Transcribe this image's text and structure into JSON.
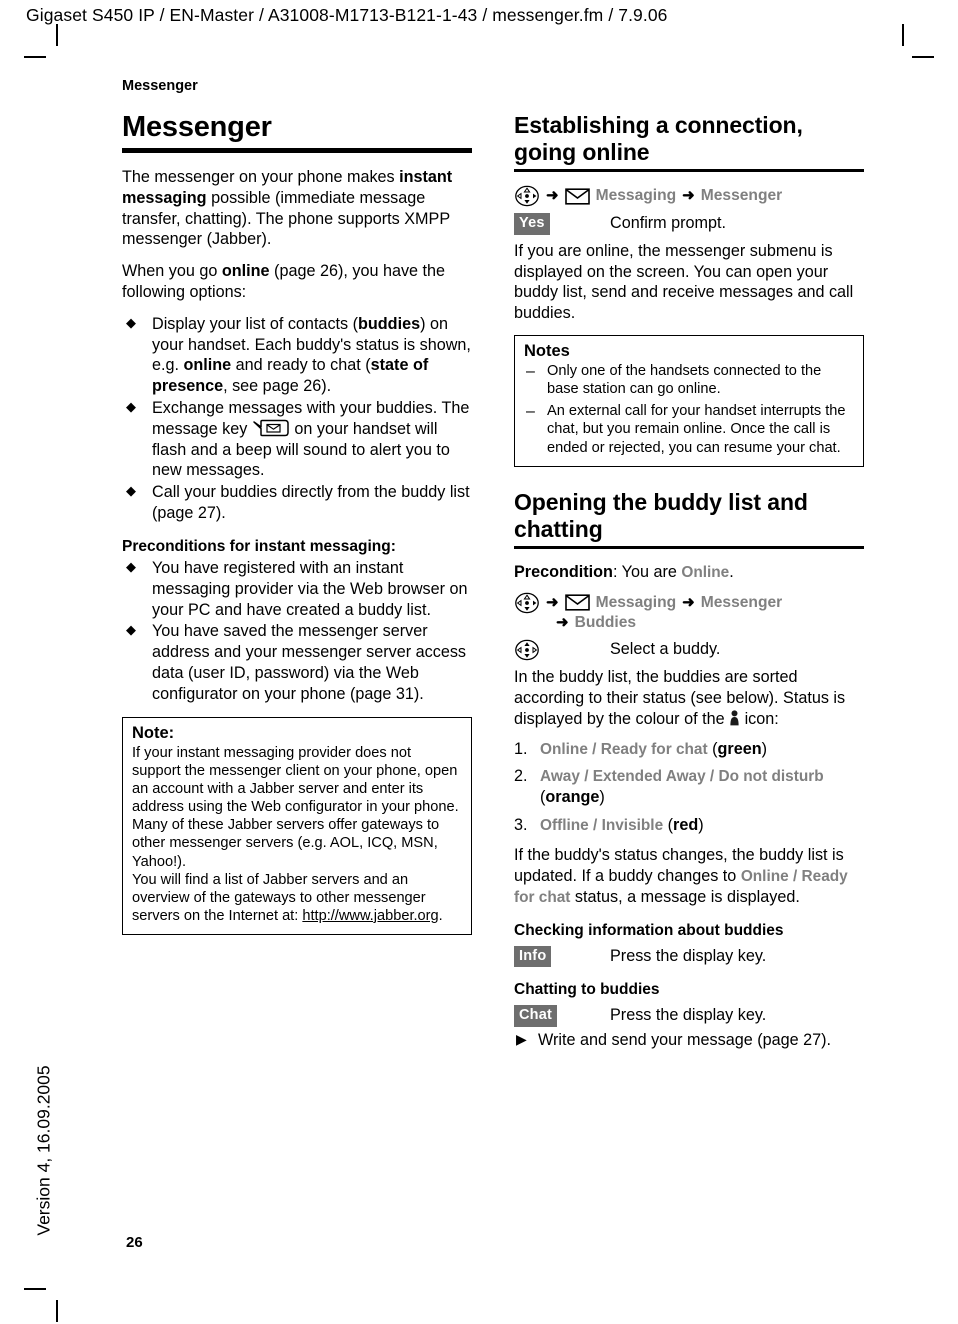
{
  "print_header": "Gigaset S450 IP / EN-Master / A31008-M1713-B121-1-43 / messenger.fm / 7.9.06",
  "version_note": "Version 4, 16.09.2005",
  "running_head": "Messenger",
  "page_number": "26",
  "colors": {
    "gray_term": "#808080",
    "display_key_bg": "#6e6e6e",
    "rule": "#000000"
  },
  "left_column": {
    "chapter_title": "Messenger",
    "intro_p1_a": "The messenger on your phone makes ",
    "intro_p1_b": "instant messaging",
    "intro_p1_c": " possible (immediate message transfer, chatting). The phone supports XMPP messenger (Jabber).",
    "intro_p2_a": "When you go ",
    "intro_p2_b": "online",
    "intro_p2_c": " (page 26), you have the following options:",
    "options": [
      {
        "bullet": "◆",
        "a": "Display your list of contacts (",
        "b1": "buddies",
        "c": ") on your handset. Each buddy's status is shown, e.g. ",
        "b2": "online",
        "d": " and ready to chat (",
        "b3": "state of presence",
        "e": ", see page 26)."
      },
      {
        "bullet": "◆",
        "a": "Exchange messages with your buddies. The message key ",
        "icon": "message-key-icon",
        "c": " on your handset will flash and a beep will sound to alert you to new messages."
      },
      {
        "bullet": "◆",
        "a": "Call your buddies directly from the buddy list (page 27)."
      }
    ],
    "preconditions_title": "Preconditions for instant messaging:",
    "preconditions": [
      {
        "bullet": "◆",
        "text": "You have registered with an instant messaging provider via the Web browser on your PC and have created a buddy list."
      },
      {
        "bullet": "◆",
        "text": "You have saved the messenger server address and your messenger server access data (user ID, password) via the Web configurator on your phone (page 31)."
      }
    ],
    "note_box": {
      "title": "Note:",
      "para1": "If your instant messaging provider does not support the messenger client on your phone, open an account with a Jabber server and enter its address using the Web configurator in your phone. Many of these Jabber servers offer gateways to other messenger servers (e.g. AOL, ICQ, MSN, Yahoo!).",
      "para2_a": "You will find a list of Jabber servers and an overview of the gateways to other messenger servers on the Internet at: ",
      "para2_url": "http://www.jabber.org",
      "para2_b": "."
    }
  },
  "right_column": {
    "section1_title": "Establishing a connection, going online",
    "menu_path_1": {
      "nav_icon": "navigation-key-icon",
      "arrow1": "➜",
      "env_icon": "envelope-icon",
      "item1": "Messaging",
      "arrow2": "➜",
      "item2": "Messenger"
    },
    "step_yes": {
      "key": "Yes",
      "text": "Confirm prompt."
    },
    "para_online": "If you are online, the messenger submenu is displayed on the screen. You can open your buddy list, send and receive messages and call buddies.",
    "notes_box": {
      "title": "Notes",
      "items": [
        {
          "bullet": "–",
          "text": "Only one of the handsets connected to the base station can go online."
        },
        {
          "bullet": "–",
          "text": "An external call for your handset interrupts the chat, but you remain online. Once the call is ended or rejected, you can resume your chat."
        }
      ]
    },
    "section2_title": "Opening the buddy list and chatting",
    "precondition_a": "Precondition",
    "precondition_b": ": You are ",
    "precondition_c": "Online",
    "precondition_d": ".",
    "menu_path_2": {
      "nav_icon": "navigation-key-icon",
      "arrow1": "➜",
      "env_icon": "envelope-icon",
      "item1": "Messaging",
      "arrow2": "➜",
      "item2": "Messenger",
      "arrow3": "➜",
      "item3": "Buddies"
    },
    "step_select": {
      "icon": "navigation-key-icon",
      "text": "Select a buddy."
    },
    "para_sorted_a": "In the buddy list, the buddies are sorted according to their status (see below). Status is displayed by the colour of the ",
    "para_sorted_icon": "buddy-status-icon",
    "para_sorted_b": " icon:",
    "status_list": [
      {
        "num": "1.",
        "terms": "Online / Ready for chat",
        "open": " (",
        "colour": "green",
        "close": ")"
      },
      {
        "num": "2.",
        "terms": "Away / Extended Away / Do not disturb",
        "open": " (",
        "colour": "orange",
        "close": ")"
      },
      {
        "num": "3.",
        "terms": "Offline / Invisible",
        "open": " (",
        "colour": "red",
        "close": ")"
      }
    ],
    "para_update_a": "If the buddy's status changes, the buddy list is updated. If a buddy changes to ",
    "para_update_b": "Online / Ready for chat",
    "para_update_c": " status, a message is displayed.",
    "sub_checking_title": "Checking information about buddies",
    "step_info": {
      "key": "Info",
      "text": "Press the display key."
    },
    "sub_chatting_title": "Chatting to buddies",
    "step_chat": {
      "key": "Chat",
      "text": "Press the display key."
    },
    "tri_item": {
      "bullet": "▶",
      "text": "Write and send your message (page 27)."
    }
  }
}
